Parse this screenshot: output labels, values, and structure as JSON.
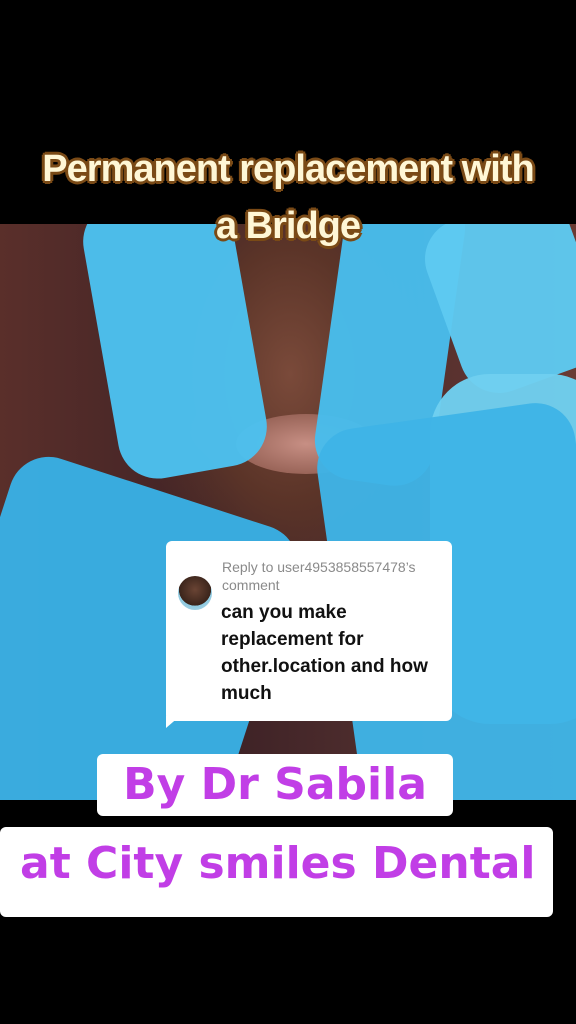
{
  "title": {
    "line1": "Permanent replacement with",
    "line2": "a Bridge"
  },
  "reply": {
    "meta": "Reply to user4953858557478’s comment",
    "body": "can you make replacement for other.location and how much",
    "avatar_icon": "user-avatar-icon"
  },
  "captions": {
    "line1": "By Dr Sabila",
    "line2": "at City smiles Dental"
  },
  "colors": {
    "caption_text": "#c13ee6",
    "glove": "#41b8ea",
    "title_fill": "#fff7d6",
    "title_outline": "#7a4a16"
  }
}
